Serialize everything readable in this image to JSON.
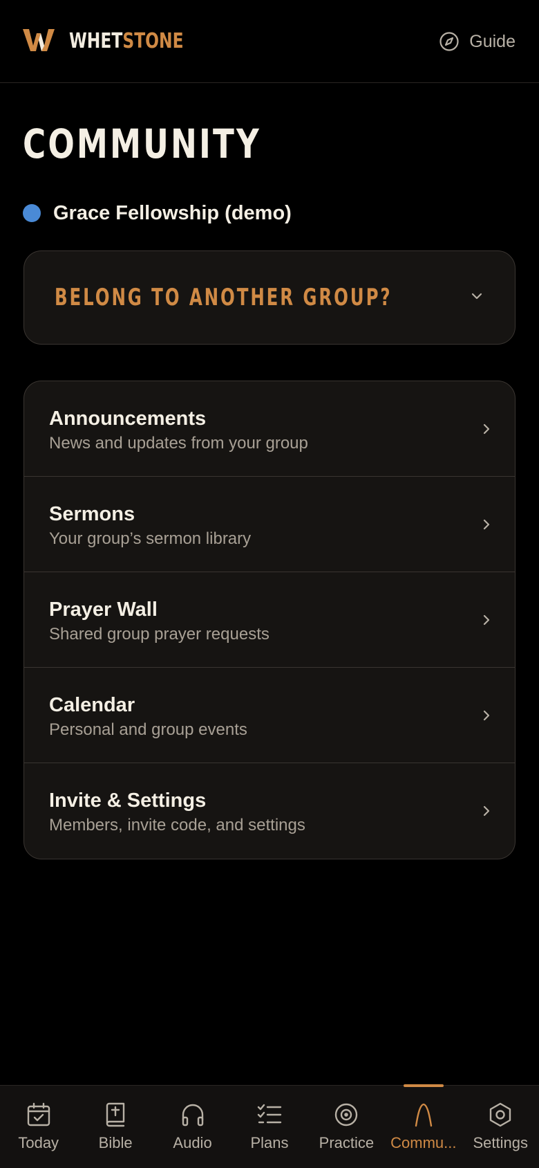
{
  "header": {
    "brand_part1": "WHET",
    "brand_part2": "STONE",
    "guide_label": "Guide",
    "guide_icon": "compass-icon"
  },
  "page": {
    "title": "COMMUNITY"
  },
  "group": {
    "name": "Grace Fellowship (demo)",
    "dot_color": "#4a8ad6"
  },
  "belong": {
    "label": "BELONG TO ANOTHER GROUP?",
    "icon": "chevron-down-icon"
  },
  "list": {
    "items": [
      {
        "title": "Announcements",
        "subtitle": "News and updates from your group"
      },
      {
        "title": "Sermons",
        "subtitle": "Your group’s sermon library"
      },
      {
        "title": "Prayer Wall",
        "subtitle": "Shared group prayer requests"
      },
      {
        "title": "Calendar",
        "subtitle": "Personal and group events"
      },
      {
        "title": "Invite & Settings",
        "subtitle": "Members, invite code, and settings"
      }
    ]
  },
  "tabs": [
    {
      "label": "Today",
      "icon": "calendar-check-icon"
    },
    {
      "label": "Bible",
      "icon": "bible-icon"
    },
    {
      "label": "Audio",
      "icon": "headphones-icon"
    },
    {
      "label": "Plans",
      "icon": "checklist-icon"
    },
    {
      "label": "Practice",
      "icon": "target-icon"
    },
    {
      "label": "Commu...",
      "icon": "arch-icon",
      "active": true
    },
    {
      "label": "Settings",
      "icon": "hexagon-settings-icon"
    }
  ],
  "colors": {
    "accent": "#d08a45",
    "background": "#000000",
    "card": "#161412",
    "text": "#f4efe4",
    "muted": "#a8a095"
  }
}
